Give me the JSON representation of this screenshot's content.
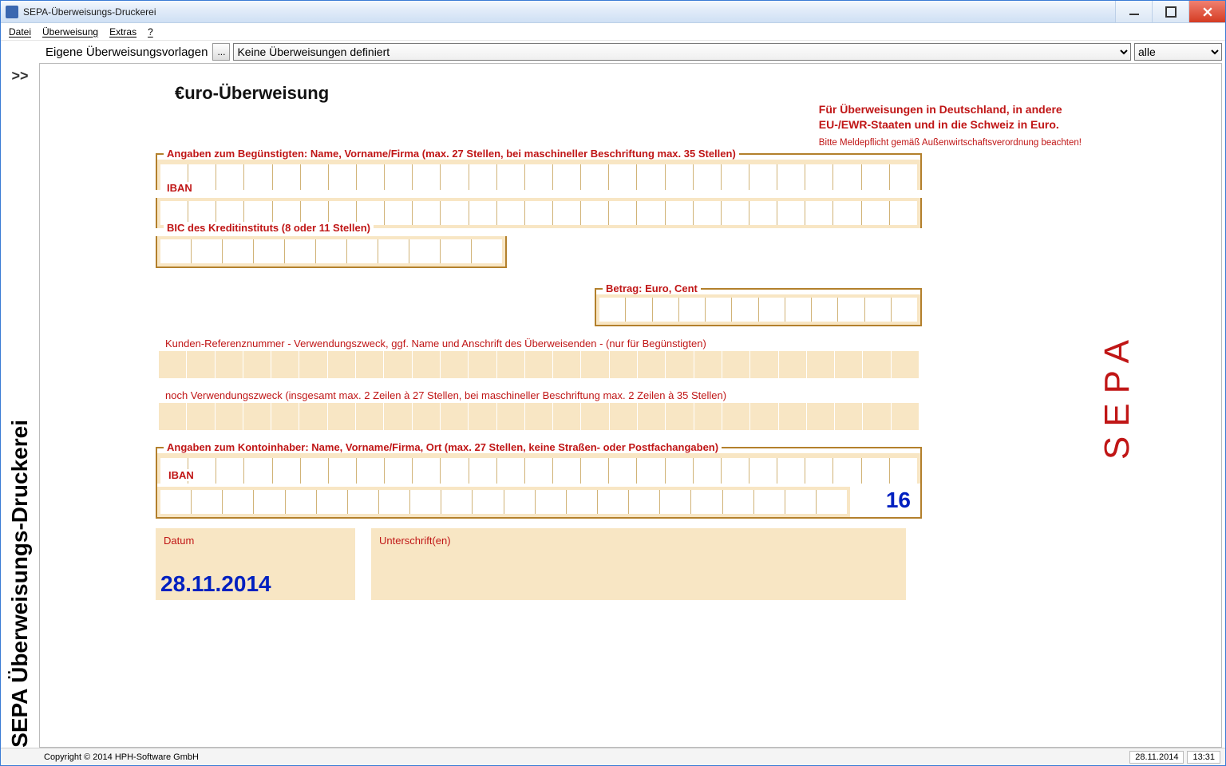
{
  "window_title": "SEPA-Überweisungs-Druckerei",
  "menu": {
    "datei": "Datei",
    "ueberweisung": "Überweisung",
    "extras": "Extras",
    "help": "?"
  },
  "toolbar": {
    "label": "Eigene Überweisungsvorlagen",
    "more": "...",
    "template_selected": "Keine Überweisungen definiert",
    "filter_selected": "alle"
  },
  "left_spine": {
    "toggle": ">>",
    "vtext": "SEPA Überweisungs-Druckerei"
  },
  "form": {
    "title": "€uro-Überweisung",
    "top_red_1": "Für Überweisungen in Deutschland, in andere",
    "top_red_2": "EU-/EWR-Staaten und in die Schweiz in Euro.",
    "top_red_small": "Bitte Meldepflicht gemäß Außenwirtschaftsverordnung beachten!",
    "sepa_v": "SEPA",
    "beg_label": "Angaben zum Begünstigten: Name, Vorname/Firma (max. 27 Stellen, bei maschineller Beschriftung max. 35 Stellen)",
    "iban_label": "IBAN",
    "bic_label": "BIC des Kreditinstituts (8 oder 11 Stellen)",
    "amount_label": "Betrag: Euro, Cent",
    "ref_label": "Kunden-Referenznummer - Verwendungszweck, ggf. Name und Anschrift des Überweisenden - (nur für Begünstigten)",
    "purpose_label": "noch Verwendungszweck (insgesamt max. 2 Zeilen à 27 Stellen, bei maschineller Beschriftung max. 2 Zeilen à 35 Stellen)",
    "holder_label": "Angaben zum Kontoinhaber: Name, Vorname/Firma, Ort (max. 27 Stellen, keine Straßen- oder Postfachangaben)",
    "iban2_label": "IBAN",
    "sixteen": "16",
    "date_label": "Datum",
    "sign_label": "Unterschrift(en)",
    "date_value": "28.11.2014"
  },
  "status": {
    "copyright": "Copyright © 2014 HPH-Software GmbH",
    "date": "28.11.2014",
    "time": "13:31"
  }
}
